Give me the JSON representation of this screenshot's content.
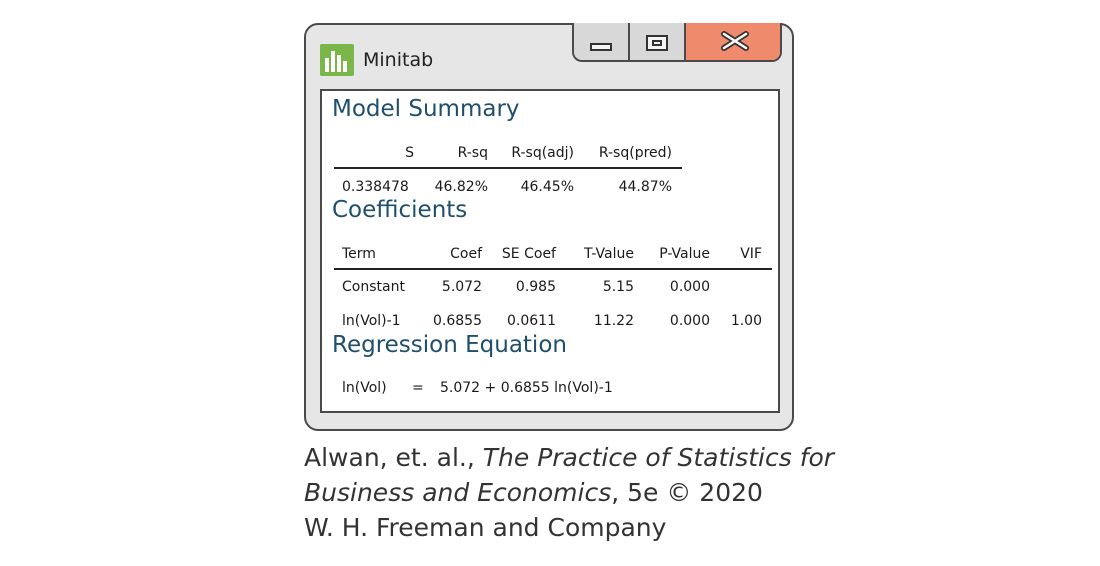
{
  "window": {
    "title": "Minitab",
    "logo_icon": "minitab-bar-chart-icon",
    "logo_color": "#7ab648",
    "close_color": "#f08a6c"
  },
  "model_summary": {
    "title": "Model Summary",
    "headers": [
      "S",
      "R-sq",
      "R-sq(adj)",
      "R-sq(pred)"
    ],
    "values": [
      "0.338478",
      "46.82%",
      "46.45%",
      "44.87%"
    ]
  },
  "coefficients": {
    "title": "Coefficients",
    "headers": [
      "Term",
      "Coef",
      "SE Coef",
      "T-Value",
      "P-Value",
      "VIF"
    ],
    "rows": [
      [
        "Constant",
        "5.072",
        "0.985",
        "5.15",
        "0.000",
        ""
      ],
      [
        "ln(Vol)-1",
        "0.6855",
        "0.0611",
        "11.22",
        "0.000",
        "1.00"
      ]
    ]
  },
  "regression_equation": {
    "title": "Regression Equation",
    "lhs": "ln(Vol)",
    "operator": "=",
    "rhs": "5.072 + 0.6855 ln(Vol)-1"
  },
  "caption": {
    "authors": "Alwan, et. al., ",
    "book_title_1": "The Practice of Statistics for",
    "book_title_2": "Business and Economics",
    "edition": ", 5e © 2020",
    "publisher": "W. H. Freeman and Company"
  }
}
